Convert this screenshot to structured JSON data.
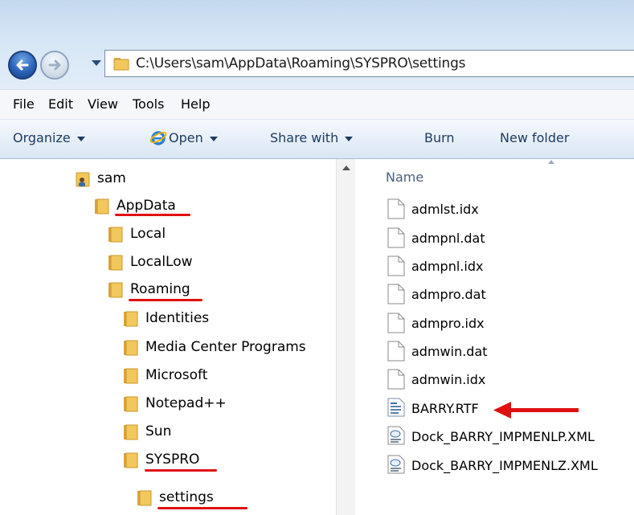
{
  "address": {
    "path": "C:\\Users\\sam\\AppData\\Roaming\\SYSPRO\\settings"
  },
  "menu": [
    "File",
    "Edit",
    "View",
    "Tools",
    "Help"
  ],
  "toolbar": {
    "organize": "Organize",
    "open": "Open",
    "share_with": "Share with",
    "burn": "Burn",
    "new_folder": "New folder"
  },
  "tree": {
    "items": [
      {
        "label": "sam",
        "icon": "user-folder-icon",
        "underlined": false
      },
      {
        "label": "AppData",
        "icon": "folder-icon",
        "underlined": true
      },
      {
        "label": "Local",
        "icon": "folder-icon",
        "underlined": false
      },
      {
        "label": "LocalLow",
        "icon": "folder-icon",
        "underlined": false
      },
      {
        "label": "Roaming",
        "icon": "folder-icon",
        "underlined": true
      },
      {
        "label": "Identities",
        "icon": "folder-icon",
        "underlined": false
      },
      {
        "label": "Media Center Programs",
        "icon": "folder-icon",
        "underlined": false
      },
      {
        "label": "Microsoft",
        "icon": "folder-icon",
        "underlined": false
      },
      {
        "label": "Notepad++",
        "icon": "folder-icon",
        "underlined": false
      },
      {
        "label": "Sun",
        "icon": "folder-icon",
        "underlined": false
      },
      {
        "label": "SYSPRO",
        "icon": "folder-icon",
        "underlined": true
      },
      {
        "label": "settings",
        "icon": "folder-icon",
        "underlined": true
      }
    ]
  },
  "files": {
    "column_name": "Name",
    "items": [
      {
        "name": "admlst.idx",
        "icon": "blank-file-icon"
      },
      {
        "name": "admpnl.dat",
        "icon": "blank-file-icon"
      },
      {
        "name": "admpnl.idx",
        "icon": "blank-file-icon"
      },
      {
        "name": "admpro.dat",
        "icon": "blank-file-icon"
      },
      {
        "name": "admpro.idx",
        "icon": "blank-file-icon"
      },
      {
        "name": "admwin.dat",
        "icon": "blank-file-icon"
      },
      {
        "name": "admwin.idx",
        "icon": "blank-file-icon"
      },
      {
        "name": "BARRY.RTF",
        "icon": "rtf-file-icon",
        "highlighted": true
      },
      {
        "name": "Dock_BARRY_IMPMENLP.XML",
        "icon": "xml-file-icon"
      },
      {
        "name": "Dock_BARRY_IMPMENLZ.XML",
        "icon": "xml-file-icon"
      }
    ]
  },
  "colors": {
    "annotation_red": "#e01010",
    "folder_yellow": "#f2c75c"
  }
}
